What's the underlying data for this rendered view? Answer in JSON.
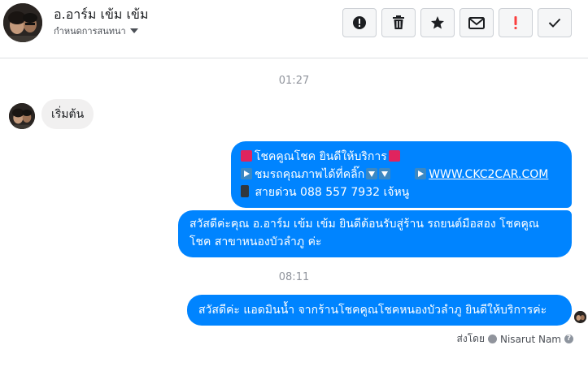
{
  "header": {
    "contact_name": "อ.อาร์ม เข้ม เข้ม",
    "label_dropdown": "กำหนดการสนทนา"
  },
  "actions": {
    "report_icon": "alert-circle-icon",
    "delete_icon": "trash-icon",
    "star_icon": "star-icon",
    "mail_icon": "envelope-icon",
    "urgent_icon": "exclamation-icon",
    "done_icon": "checkmark-icon"
  },
  "timestamps": [
    "01:27",
    "08:11"
  ],
  "messages": [
    {
      "direction": "incoming",
      "text": "เริ่มต้น"
    },
    {
      "direction": "outgoing",
      "line1": "โชคคูณโชค ยินดีให้บริการ",
      "line2": "ชมรถคุณภาพได้ที่คลิ๊ก",
      "link": "WWW.CKC2CAR.COM",
      "line3": "สายด่วน 088 557 7932 เจ้หนู"
    },
    {
      "direction": "outgoing",
      "text": "สวัสดีค่ะคุณ อ.อาร์ม เข้ม เข้ม ยินดีต้อนรับสู่ร้าน รถยนต์มือสอง โชคคูณ โชค สาขาหนองบัวลำภู ค่ะ"
    },
    {
      "direction": "outgoing",
      "text": "สวัสดีค่ะ แอดมินน้ำ จากร้านโชคคูณโชคหนองบัวลำภู ยินดีให้บริการค่ะ"
    }
  ],
  "footer": {
    "sent_by_label": "ส่งโดย",
    "sender_name": "Nisarut Nam"
  },
  "colors": {
    "outgoing_bubble": "#0084ff",
    "incoming_bubble": "#f1f0f0",
    "urgent": "#fa3e3e"
  }
}
